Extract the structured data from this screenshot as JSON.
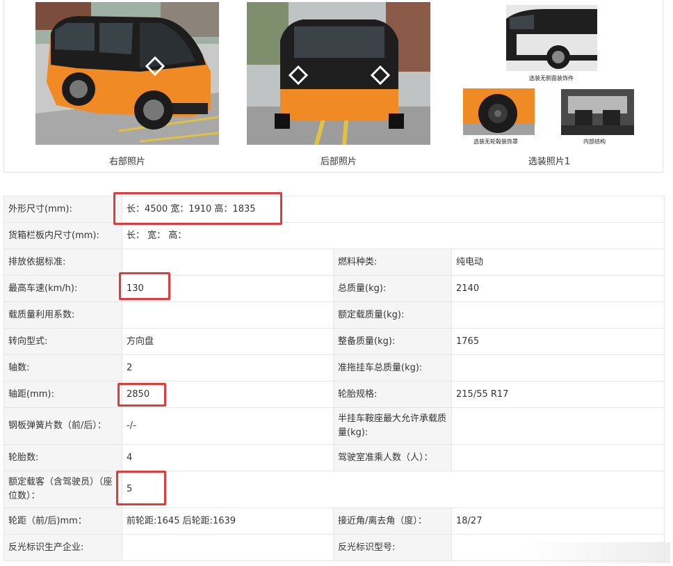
{
  "photos": {
    "right_caption": "右部照片",
    "rear_caption": "后部照片",
    "optional_caption": "选装照片1",
    "optional_sub": {
      "side_trim": "选装无侧面装饰件",
      "no_wheel_cover": "选装无轮毂装饰罩",
      "interior": "内部结构"
    }
  },
  "specs": {
    "dimensions_label": "外形尺寸(mm):",
    "dimensions_value": "长：4500 宽：1910 高：1835",
    "cargo_label": "货箱栏板内尺寸(mm):",
    "cargo_value": "长：  宽：  高：",
    "emission_label": "排放依据标准:",
    "emission_value": "",
    "fuel_label": "燃料种类:",
    "fuel_value": "纯电动",
    "max_speed_label": "最高车速(km/h):",
    "max_speed_value": "130",
    "total_mass_label": "总质量(kg):",
    "total_mass_value": "2140",
    "load_coef_label": "载质量利用系数:",
    "load_coef_value": "",
    "rated_load_label": "额定载质量(kg):",
    "rated_load_value": "",
    "steering_label": "转向型式:",
    "steering_value": "方向盘",
    "curb_mass_label": "整备质量(kg):",
    "curb_mass_value": "1765",
    "axles_label": "轴数:",
    "axles_value": "2",
    "trailer_label": "准拖挂车总质量(kg):",
    "trailer_value": "",
    "wheelbase_label": "轴距(mm):",
    "wheelbase_value": "2850",
    "tire_spec_label": "轮胎规格:",
    "tire_spec_value": "215/55 R17",
    "spring_label": "钢板弹簧片数（前/后）：",
    "spring_value": "-/-",
    "saddle_label": "半挂车鞍座最大允许承载质量(kg):",
    "saddle_value": "",
    "tires_label": "轮胎数:",
    "tires_value": "4",
    "cab_label": "驾驶室准乘人数（人）：",
    "cab_value": "",
    "seats_label": "额定载客（含驾驶员）（座位数）：",
    "seats_value": "5",
    "track_label": "轮距（前/后)mm：",
    "track_value": "前轮距:1645 后轮距:1639",
    "angle_label": "接近角/离去角（度）：",
    "angle_value": "18/27",
    "reflector_maker_label": "反光标识生产企业:",
    "reflector_maker_value": "",
    "reflector_model_label": "反光标识型号:",
    "reflector_model_value": ""
  },
  "colors": {
    "highlight": "#e03b3b",
    "vehicle_orange": "#f08a24",
    "label_bg": "#f5f5f5"
  }
}
